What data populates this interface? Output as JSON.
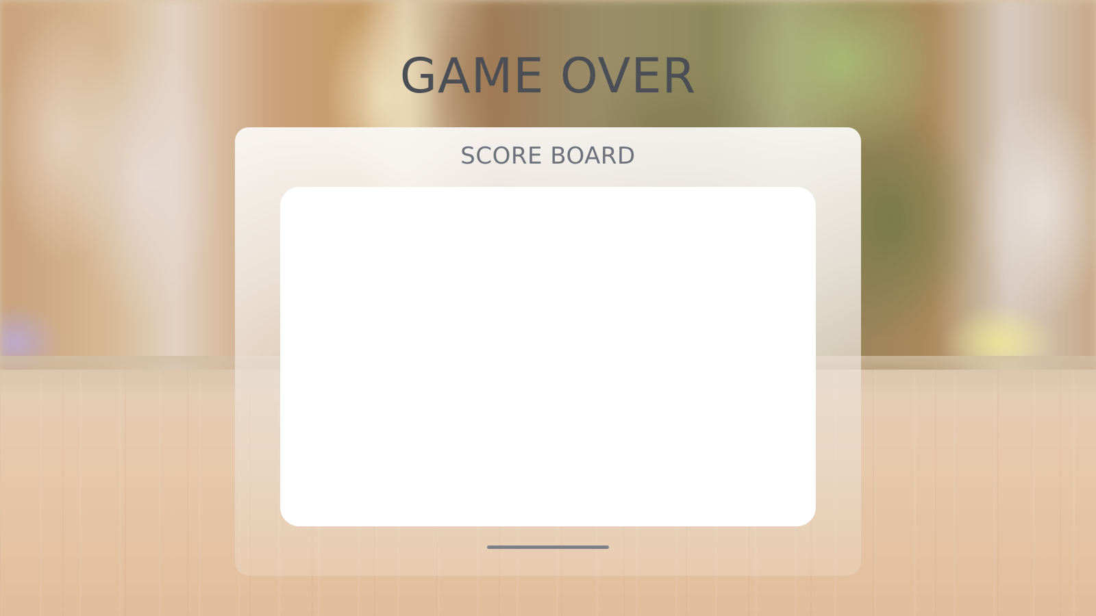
{
  "screen": {
    "title": "GAME OVER"
  },
  "scoreboard": {
    "heading": "SCORE BOARD",
    "entries": []
  },
  "colors": {
    "title_text": "#4b4e54",
    "heading_text": "#6d717b",
    "list_background": "#ffffff",
    "handle": "#7b7f86"
  }
}
